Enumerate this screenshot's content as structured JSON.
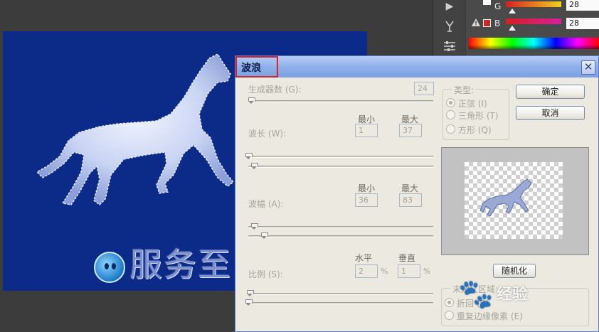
{
  "color_panel": {
    "row_g": {
      "label": "G",
      "value": "28"
    },
    "row_b": {
      "label": "B",
      "value": "28"
    },
    "warn_icon": "warning-icon"
  },
  "canvas": {
    "logo_text": "服务至"
  },
  "dialog": {
    "title": "波浪",
    "close_label": "✕",
    "generators": {
      "label": "生成器数 (G):",
      "value": "24"
    },
    "wavelength": {
      "label": "波长 (W):",
      "min_header": "最小",
      "max_header": "最大",
      "min": "1",
      "max": "37"
    },
    "amplitude": {
      "label": "波幅 (A):",
      "min_header": "最小",
      "max_header": "最大",
      "min": "36",
      "max": "83"
    },
    "scale": {
      "label": "比例 (S):",
      "h_header": "水平",
      "v_header": "垂直",
      "h": "2",
      "v": "1",
      "unit": "%"
    },
    "type": {
      "title": "类型:",
      "options": [
        {
          "label": "正弦 (I)",
          "selected": true
        },
        {
          "label": "三角形 (T)",
          "selected": false
        },
        {
          "label": "方形 (Q)",
          "selected": false
        }
      ]
    },
    "ok_button": "确定",
    "cancel_button": "取消",
    "randomize_button": "随机化",
    "undefined_area": {
      "title": "未定义区域:",
      "options": [
        {
          "label": "折回 (R)",
          "selected": true
        },
        {
          "label": "重复边缘像素 (E)",
          "selected": false
        }
      ]
    }
  },
  "watermark": {
    "text": "经验"
  }
}
